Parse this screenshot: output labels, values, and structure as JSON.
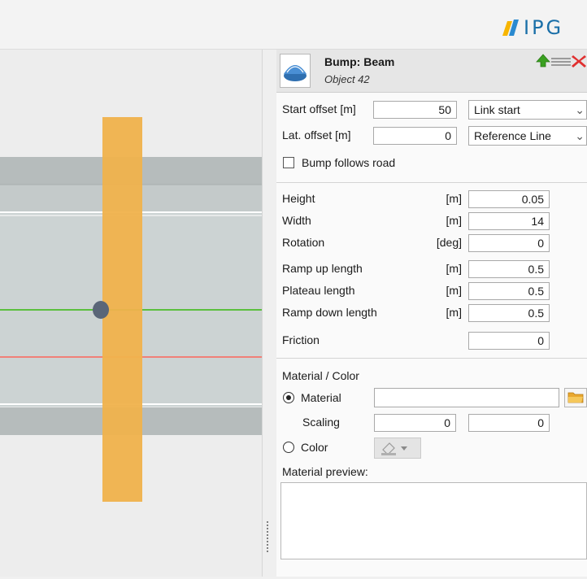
{
  "brand": {
    "text": "IPG"
  },
  "object": {
    "title": "Bump: Beam",
    "subtitle": "Object 42"
  },
  "position": {
    "start_offset_label": "Start offset [m]",
    "start_offset_value": "50",
    "start_offset_ref": "Link start",
    "lat_offset_label": "Lat. offset  [m]",
    "lat_offset_value": "0",
    "lat_offset_ref": "Reference Line",
    "follows_road_label": "Bump follows road"
  },
  "geometry": [
    {
      "label": "Height",
      "unit": "[m]",
      "value": "0.05"
    },
    {
      "label": "Width",
      "unit": "[m]",
      "value": "14"
    },
    {
      "label": "Rotation",
      "unit": "[deg]",
      "value": "0"
    },
    {
      "label": "Ramp up length",
      "unit": "[m]",
      "value": "0.5"
    },
    {
      "label": "Plateau length",
      "unit": "[m]",
      "value": "0.5"
    },
    {
      "label": "Ramp down length",
      "unit": "[m]",
      "value": "0.5"
    },
    {
      "label": "Friction",
      "unit": "",
      "value": "0"
    }
  ],
  "material": {
    "section_title": "Material / Color",
    "material_label": "Material",
    "material_value": "",
    "scaling_label": "Scaling",
    "scaling_x": "0",
    "scaling_y": "0",
    "color_label": "Color",
    "preview_label": "Material preview:",
    "selected": "Material"
  },
  "colors": {
    "bump": "#f0b24c",
    "centerline": "#5bbf3e",
    "referenceline": "#f08078",
    "marker": "#5a6678"
  }
}
